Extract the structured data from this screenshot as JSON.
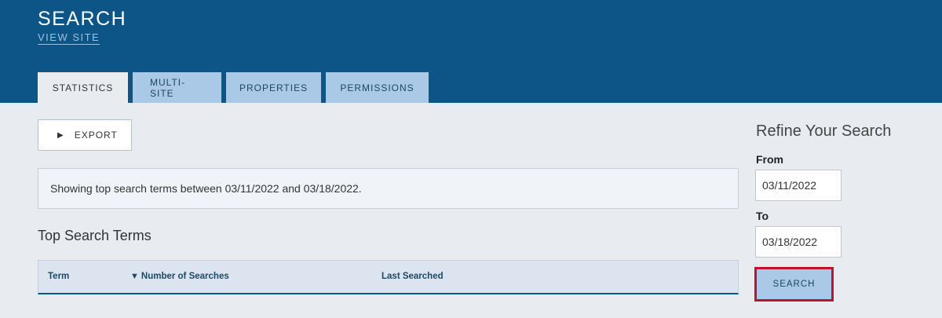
{
  "header": {
    "title": "SEARCH",
    "view_site": "VIEW SITE",
    "tabs": [
      {
        "label": "STATISTICS",
        "active": true
      },
      {
        "label": "MULTI-SITE",
        "active": false
      },
      {
        "label": "PROPERTIES",
        "active": false
      },
      {
        "label": "PERMISSIONS",
        "active": false
      }
    ]
  },
  "main": {
    "export_label": "EXPORT",
    "info_text": "Showing top search terms between 03/11/2022 and 03/18/2022.",
    "section_title": "Top Search Terms",
    "table": {
      "columns": [
        "Term",
        "Number of Searches",
        "Last Searched"
      ],
      "sort_indicator": "▼",
      "rows": []
    }
  },
  "refine": {
    "title": "Refine Your Search",
    "from_label": "From",
    "from_value": "03/11/2022",
    "to_label": "To",
    "to_value": "03/18/2022",
    "search_label": "SEARCH"
  },
  "colors": {
    "header_bg": "#0d5587",
    "tab_bg": "#a9c9e6",
    "page_bg": "#e8ecf0",
    "highlight_border": "#c0122c"
  }
}
